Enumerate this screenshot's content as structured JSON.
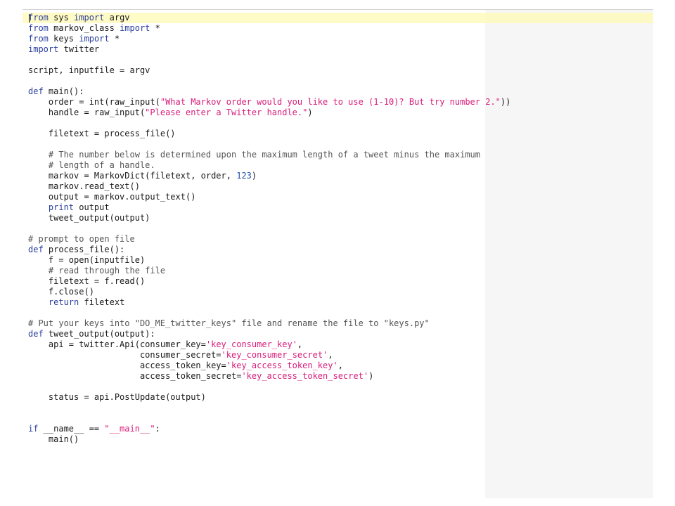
{
  "colors": {
    "keyword": "#2a3f9e",
    "string": "#d81b7a",
    "number": "#1f4fa8",
    "comment": "#555555",
    "text": "#1a1a1a",
    "current_line": "#fffab4",
    "margin_column": "#f6f6f6"
  },
  "editor": {
    "current_line_index": 0,
    "lines": [
      [
        {
          "t": "from",
          "c": "kw"
        },
        {
          "t": " sys ",
          "c": "tok"
        },
        {
          "t": "import",
          "c": "kw"
        },
        {
          "t": " argv",
          "c": "tok"
        }
      ],
      [
        {
          "t": "from",
          "c": "kw"
        },
        {
          "t": " markov_class ",
          "c": "tok"
        },
        {
          "t": "import",
          "c": "kw"
        },
        {
          "t": " *",
          "c": "tok"
        }
      ],
      [
        {
          "t": "from",
          "c": "kw"
        },
        {
          "t": " keys ",
          "c": "tok"
        },
        {
          "t": "import",
          "c": "kw"
        },
        {
          "t": " *",
          "c": "tok"
        }
      ],
      [
        {
          "t": "import",
          "c": "kw"
        },
        {
          "t": " twitter",
          "c": "tok"
        }
      ],
      [],
      [
        {
          "t": "script, inputfile = argv",
          "c": "tok"
        }
      ],
      [],
      [
        {
          "t": "def",
          "c": "kw"
        },
        {
          "t": " main():",
          "c": "tok"
        }
      ],
      [
        {
          "t": "    order = int(raw_input(",
          "c": "tok"
        },
        {
          "t": "\"What Markov order would you like to use (1-10)? But try number 2.\"",
          "c": "str"
        },
        {
          "t": "))",
          "c": "tok"
        }
      ],
      [
        {
          "t": "    handle = raw_input(",
          "c": "tok"
        },
        {
          "t": "\"Please enter a Twitter handle.\"",
          "c": "str"
        },
        {
          "t": ")",
          "c": "tok"
        }
      ],
      [],
      [
        {
          "t": "    filetext = process_file()",
          "c": "tok"
        }
      ],
      [],
      [
        {
          "t": "    # The number below is determined upon the maximum length of a tweet minus the maximum",
          "c": "com"
        }
      ],
      [
        {
          "t": "    # length of a handle.",
          "c": "com"
        }
      ],
      [
        {
          "t": "    markov = MarkovDict(filetext, order, ",
          "c": "tok"
        },
        {
          "t": "123",
          "c": "num"
        },
        {
          "t": ")",
          "c": "tok"
        }
      ],
      [
        {
          "t": "    markov.read_text()",
          "c": "tok"
        }
      ],
      [
        {
          "t": "    output = markov.output_text()",
          "c": "tok"
        }
      ],
      [
        {
          "t": "    ",
          "c": "tok"
        },
        {
          "t": "print",
          "c": "kw"
        },
        {
          "t": " output",
          "c": "tok"
        }
      ],
      [
        {
          "t": "    tweet_output(output)",
          "c": "tok"
        }
      ],
      [],
      [
        {
          "t": "# prompt to open file",
          "c": "com"
        }
      ],
      [
        {
          "t": "def",
          "c": "kw"
        },
        {
          "t": " process_file():",
          "c": "tok"
        }
      ],
      [
        {
          "t": "    f = open(inputfile)",
          "c": "tok"
        }
      ],
      [
        {
          "t": "    # read through the file",
          "c": "com"
        }
      ],
      [
        {
          "t": "    filetext = f.read()",
          "c": "tok"
        }
      ],
      [
        {
          "t": "    f.close()",
          "c": "tok"
        }
      ],
      [
        {
          "t": "    ",
          "c": "tok"
        },
        {
          "t": "return",
          "c": "kw"
        },
        {
          "t": " filetext",
          "c": "tok"
        }
      ],
      [],
      [
        {
          "t": "# Put your keys into \"DO_ME_twitter_keys\" file and rename the file to \"keys.py\"",
          "c": "com"
        }
      ],
      [
        {
          "t": "def",
          "c": "kw"
        },
        {
          "t": " tweet_output(output):",
          "c": "tok"
        }
      ],
      [
        {
          "t": "    api = twitter.Api(consumer_key=",
          "c": "tok"
        },
        {
          "t": "'key_consumer_key'",
          "c": "str"
        },
        {
          "t": ",",
          "c": "tok"
        }
      ],
      [
        {
          "t": "                      consumer_secret=",
          "c": "tok"
        },
        {
          "t": "'key_consumer_secret'",
          "c": "str"
        },
        {
          "t": ",",
          "c": "tok"
        }
      ],
      [
        {
          "t": "                      access_token_key=",
          "c": "tok"
        },
        {
          "t": "'key_access_token_key'",
          "c": "str"
        },
        {
          "t": ",",
          "c": "tok"
        }
      ],
      [
        {
          "t": "                      access_token_secret=",
          "c": "tok"
        },
        {
          "t": "'key_access_token_secret'",
          "c": "str"
        },
        {
          "t": ")",
          "c": "tok"
        }
      ],
      [],
      [
        {
          "t": "    status = api.PostUpdate(output)",
          "c": "tok"
        }
      ],
      [],
      [],
      [
        {
          "t": "if",
          "c": "kw"
        },
        {
          "t": " __name__ == ",
          "c": "tok"
        },
        {
          "t": "\"__main__\"",
          "c": "str"
        },
        {
          "t": ":",
          "c": "tok"
        }
      ],
      [
        {
          "t": "    main()",
          "c": "tok"
        }
      ]
    ]
  }
}
